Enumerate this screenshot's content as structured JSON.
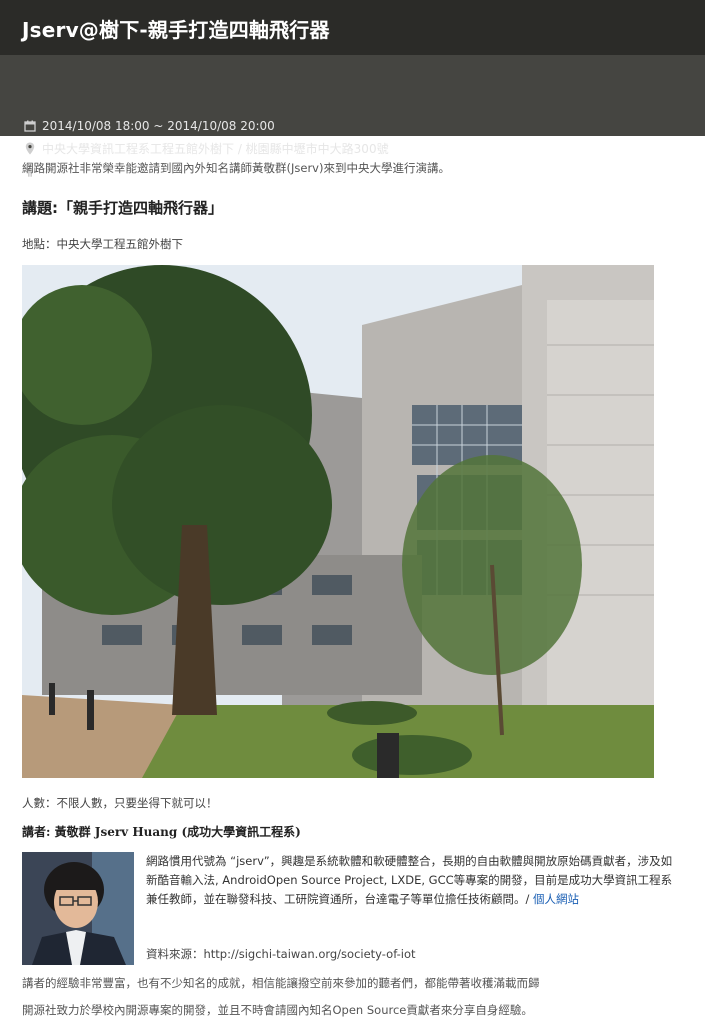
{
  "header": {
    "title": "Jserv@樹下-親手打造四軸飛行器"
  },
  "meta": {
    "datetime": "2014/10/08 18:00 ~ 2014/10/08 20:00",
    "location": "中央大學資訊工程系工程五館外樹下 / 桃園縣中壢市中大路300號",
    "capacity": "∞",
    "icons": [
      "calendar-icon",
      "map-pin-icon",
      "person-icon"
    ]
  },
  "article": {
    "intro": "網路開源社非常榮幸能邀請到國內外知名講師黃敬群(Jserv)來到中央大學進行演講。",
    "topic": "講題:「親手打造四軸飛行器」",
    "venue": "地點：中央大學工程五館外樹下",
    "attendance": "人數：不限人數，只要坐得下就可以！",
    "speaker_heading": "講者: 黃敬群 Jserv Huang (成功大學資訊工程系)",
    "bio_text": "網路慣用代號為 “jserv”，興趣是系統軟體和軟硬體整合，長期的自由軟體與開放原始碼貢獻者，涉及如新酷音輸入法, AndroidOpen Source Project, LXDE, GCC等專案的開發，目前是成功大學資訊工程系兼任教師，並在聯發科技、工研院資通所，台達電子等單位擔任技術顧問。/ ",
    "bio_link": "個人網站",
    "source": "資料來源：http://sigchi-taiwan.org/society-of-iot",
    "experience": "講者的經驗非常豐富，也有不少知名的成就，相信能讓撥空前來參加的聽者們，都能帶著收穫滿載而歸",
    "club": "開源社致力於學校內開源專案的開發，並且不時會請國內知名Open Source貢獻者來分享自身經驗。"
  },
  "colors": {
    "header_bg": "#2b2b28",
    "meta_bg": "#454541",
    "link": "#1a5fb4"
  }
}
